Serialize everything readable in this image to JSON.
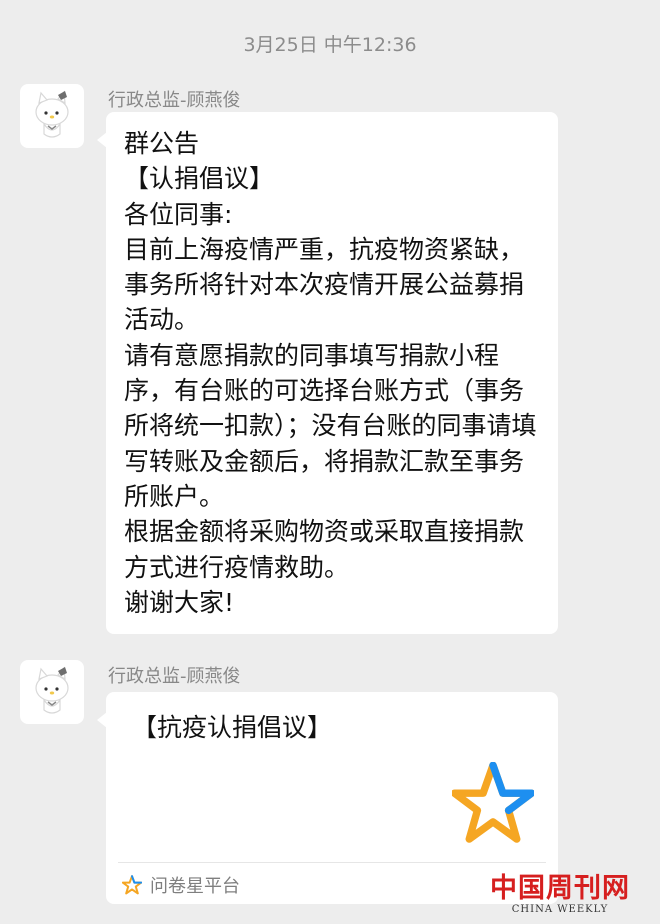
{
  "timestamp": "3月25日 中午12:36",
  "messages": [
    {
      "sender": "行政总监-顾燕俊",
      "avatar": "hello-kitty-avatar",
      "text": "群公告\n【认捐倡议】\n各位同事:\n目前上海疫情严重，抗疫物资紧缺，事务所将针对本次疫情开展公益募捐活动。\n请有意愿捐款的同事填写捐款小程序，有台账的可选择台账方式（事务所将统一扣款）；没有台账的同事请填写转账及金额后，将捐款汇款至事务所账户。\n根据金额将采购物资或采取直接捐款方式进行疫情救助。\n谢谢大家!"
    },
    {
      "sender": "行政总监-顾燕俊",
      "avatar": "hello-kitty-avatar",
      "card": {
        "title": "【抗疫认捐倡议】",
        "icon": "wenjuanxing-star-logo",
        "source": "问卷星平台"
      }
    }
  ],
  "watermark": {
    "cn": "中国周刊网",
    "en": "CHINA WEEKLY"
  },
  "colors": {
    "background": "#ededed",
    "bubble": "#ffffff",
    "star_blue": "#1d8ff0",
    "star_orange": "#f5a623",
    "watermark_red": "#d61f1f"
  }
}
